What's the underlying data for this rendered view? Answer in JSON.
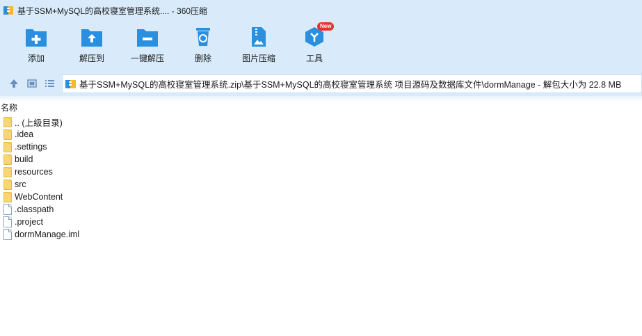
{
  "window": {
    "title": "基于SSM+MySQL的高校寝室管理系统.... - 360压缩"
  },
  "toolbar": {
    "items": [
      {
        "label": "添加",
        "icon": "add-icon"
      },
      {
        "label": "解压到",
        "icon": "extract-to-icon"
      },
      {
        "label": "一键解压",
        "icon": "one-click-extract-icon"
      },
      {
        "label": "删除",
        "icon": "delete-icon"
      },
      {
        "label": "图片压缩",
        "icon": "image-compress-icon"
      },
      {
        "label": "工具",
        "icon": "tools-icon",
        "badge": "New"
      }
    ]
  },
  "address": {
    "path": "基于SSM+MySQL的高校寝室管理系统.zip\\基于SSM+MySQL的高校寝室管理系统 项目源码及数据库文件\\dormManage - 解包大小为 22.8 MB"
  },
  "list": {
    "column_name": "名称",
    "items": [
      {
        "name": ".. (上级目录)",
        "type": "folder"
      },
      {
        "name": ".idea",
        "type": "folder"
      },
      {
        "name": ".settings",
        "type": "folder"
      },
      {
        "name": "build",
        "type": "folder"
      },
      {
        "name": "resources",
        "type": "folder"
      },
      {
        "name": "src",
        "type": "folder"
      },
      {
        "name": "WebContent",
        "type": "folder"
      },
      {
        "name": ".classpath",
        "type": "file"
      },
      {
        "name": ".project",
        "type": "file"
      },
      {
        "name": "dormManage.iml",
        "type": "file"
      }
    ]
  },
  "colors": {
    "chrome_bg": "#d9ebfb",
    "icon_blue": "#2b8fe0",
    "badge_red": "#e8322e",
    "folder_yellow": "#f7d774"
  }
}
